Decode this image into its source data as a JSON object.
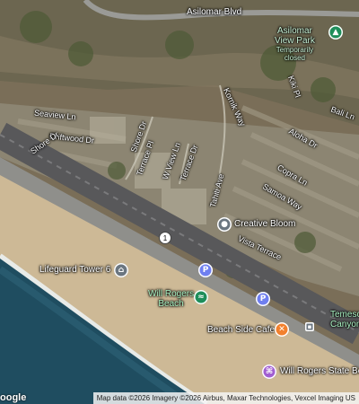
{
  "streets": {
    "asilomar_blvd": "Asilomar Blvd",
    "seaview_ln": "Seaview Ln",
    "driftwood_dr": "Driftwood Dr",
    "shore_dr": "Shore Dr",
    "shore_dr_2": "Shore Dr",
    "terrace_pl": "Terrace Pl",
    "w_view_ln": "W View Ln",
    "terrace_dr": "Terrace Dr",
    "kornik_way": "Kornik Way",
    "kiki_pl": "Kiki Pl",
    "bali_ln": "Bali Ln",
    "aloha_dr": "Aloha Dr",
    "copra_ln": "Copra Ln",
    "samoa_way": "Samoa Way",
    "tahiti_ave": "Tahiti Ave",
    "vista_terrace": "Vista Terrace"
  },
  "pois": {
    "park_name_1": "Asilomar",
    "park_name_2": "View Park",
    "park_status_1": "Temporarily",
    "park_status_2": "closed",
    "creative_bloom": "Creative Bloom",
    "lifeguard_tower": "Lifeguard Tower 6",
    "will_rogers_beach_1": "Will Rogers",
    "will_rogers_beach_2": "Beach",
    "beach_side_cafe": "Beach Side Cafe",
    "will_rogers_state": "Will Rogers State Be",
    "temescal_1": "Temesca",
    "temescal_2": "Canyon"
  },
  "route_shield": "1",
  "parking_label": "P",
  "attribution": "Map data ©2026 Imagery ©2026 Airbus, Maxar Technologies, Vexcel Imaging US",
  "brand": "oogle",
  "colors": {
    "park_green": "#1e8e5a",
    "parking_blue": "#6f7ff0",
    "food_orange": "#f2802d",
    "poi_gray": "#6b7680",
    "purple": "#a15ed1"
  }
}
